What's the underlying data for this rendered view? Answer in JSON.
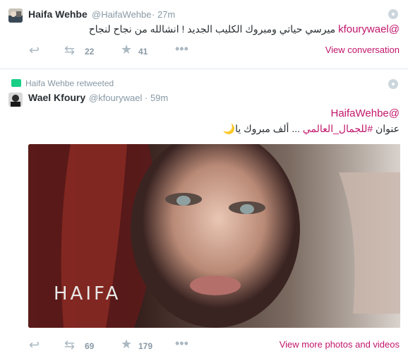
{
  "tweets": [
    {
      "name": "Haifa Wehbe",
      "handle": "@HaifaWehbe",
      "time": "· 27m",
      "mention": "@kfourywael",
      "text": "ميرسي حياتي ومبروك الكليب الجديد ! انشالله من نجاح لنجاح",
      "retweets": "22",
      "favorites": "41",
      "link": "View conversation"
    },
    {
      "retweeted_by": "Haifa Wehbe retweeted",
      "name": "Wael Kfoury",
      "handle": "@kfourywael",
      "time": "· 59m",
      "mention": "@HaifaWehbe",
      "text_plain": "عنوان",
      "hashtag": "#للجمال_العالمي",
      "text_tail": "... ألف مبروك يا🌙",
      "media_watermark": "HAIFA",
      "retweets": "69",
      "favorites": "179",
      "link": "View more photos and videos"
    }
  ],
  "icons": {
    "reply": "reply-icon",
    "retweet": "retweet-icon",
    "favorite": "star-icon",
    "more": "more-dots-icon",
    "settings": "gear-icon"
  },
  "colors": {
    "accent": "#c1166b",
    "muted": "#8899a6",
    "icon": "#aab8c2"
  }
}
